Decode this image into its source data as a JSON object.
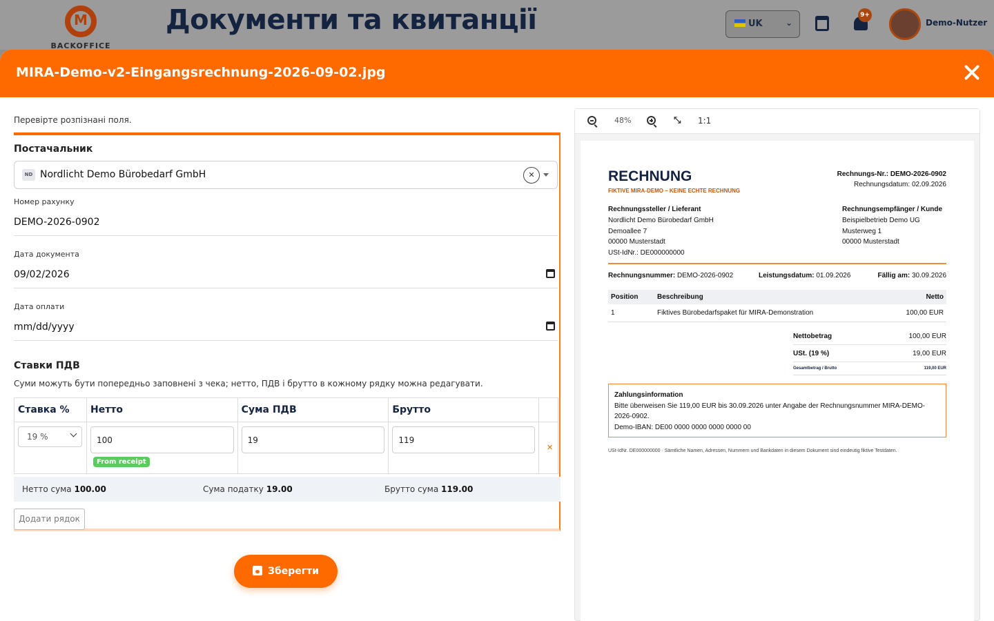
{
  "app": {
    "brand": "BACKOFFICE",
    "page_title": "Документи та квитанції",
    "language": "UK",
    "notifications_badge": "9+",
    "user_name": "Demo-Nutzer"
  },
  "modal": {
    "title": "MIRA-Demo-v2-Eingangsrechnung-2026-09-02.jpg",
    "hint": "Перевірте розпізнані поля."
  },
  "form": {
    "supplier_label": "Постачальник",
    "supplier_initials": "ND",
    "supplier_value": "Nordlicht Demo Bürobedarf GmbH",
    "invoice_no_label": "Номер рахунку",
    "invoice_no_value": "DEMO-2026-0902",
    "doc_date_label": "Дата документа",
    "doc_date_value": "09/02/2026",
    "pay_date_label": "Дата оплати",
    "pay_date_value": "mm/dd/yyyy",
    "vat_title": "Ставки ПДВ",
    "vat_note": "Суми можуть бути попередньо заповнені з чека; нетто, ПДВ і брутто в кожному рядку можна редагувати.",
    "vat_headers": [
      "Ставка %",
      "Нетто",
      "Сума ПДВ",
      "Брутто"
    ],
    "vat_rows": [
      {
        "rate": "19 %",
        "net": "100",
        "vat": "19",
        "gross": "119",
        "tag": "From receipt"
      }
    ],
    "totals": {
      "net_label": "Нетто сума",
      "net_value": "100.00",
      "tax_label": "Сума податку",
      "tax_value": "19.00",
      "gross_label": "Брутто сума",
      "gross_value": "119.00"
    },
    "add_row_label": "Додати рядок",
    "save_label": "Зберегти"
  },
  "viewer": {
    "zoom": "48%",
    "one_to_one": "1:1"
  },
  "receipt": {
    "title": "RECHNUNG",
    "subtitle": "FIKTIVE MIRA-DEMO – KEINE ECHTE RECHNUNG",
    "nr_label": "Rechnungs-Nr.: DEMO-2026-0902",
    "date_line": "Rechnungsdatum: 02.09.2026",
    "seller_heading": "Rechnungssteller / Lieferant",
    "seller_lines": [
      "Nordlicht Demo Bürobedarf GmbH",
      "Demoallee 7",
      "00000 Musterstadt",
      "USt-IdNr.: DE000000000"
    ],
    "buyer_heading": "Rechnungsempfänger / Kunde",
    "buyer_lines": [
      "Beispielbetrieb Demo UG",
      "Musterweg 1",
      "00000 Musterstadt"
    ],
    "meta_invoice_label": "Rechnungsnummer:",
    "meta_invoice_value": " DEMO-2026-0902",
    "meta_service_label": "Leistungsdatum:",
    "meta_service_value": " 01.09.2026",
    "meta_due_label": "Fällig am:",
    "meta_due_value": " 30.09.2026",
    "item_headers": [
      "Position",
      "Beschreibung",
      "Netto"
    ],
    "items": [
      {
        "pos": "1",
        "desc": "Fiktives Bürobedarfspaket für MIRA-Demonstration",
        "net": "100,00 EUR"
      }
    ],
    "net_label": "Nettobetrag",
    "net_value": "100,00 EUR",
    "vat_label": "USt. (19 %)",
    "vat_value": "19,00 EUR",
    "gross_label": "Gesamtbetrag / Brutto",
    "gross_value": "119,00 EUR",
    "pay_heading": "Zahlungsinformation",
    "pay_text": "Bitte überweisen Sie 119,00 EUR bis 30.09.2026 unter Angabe der Rechnungsnummer MIRA-DEMO-2026-0902.",
    "pay_iban": "Demo-IBAN: DE00 0000 0000 0000 0000 00",
    "footer": "USt-IdNr. DE000000000 · Sämtliche Namen, Adressen, Nummern und Bankdaten in diesem Dokument sind eindeutig fiktive Testdaten."
  }
}
